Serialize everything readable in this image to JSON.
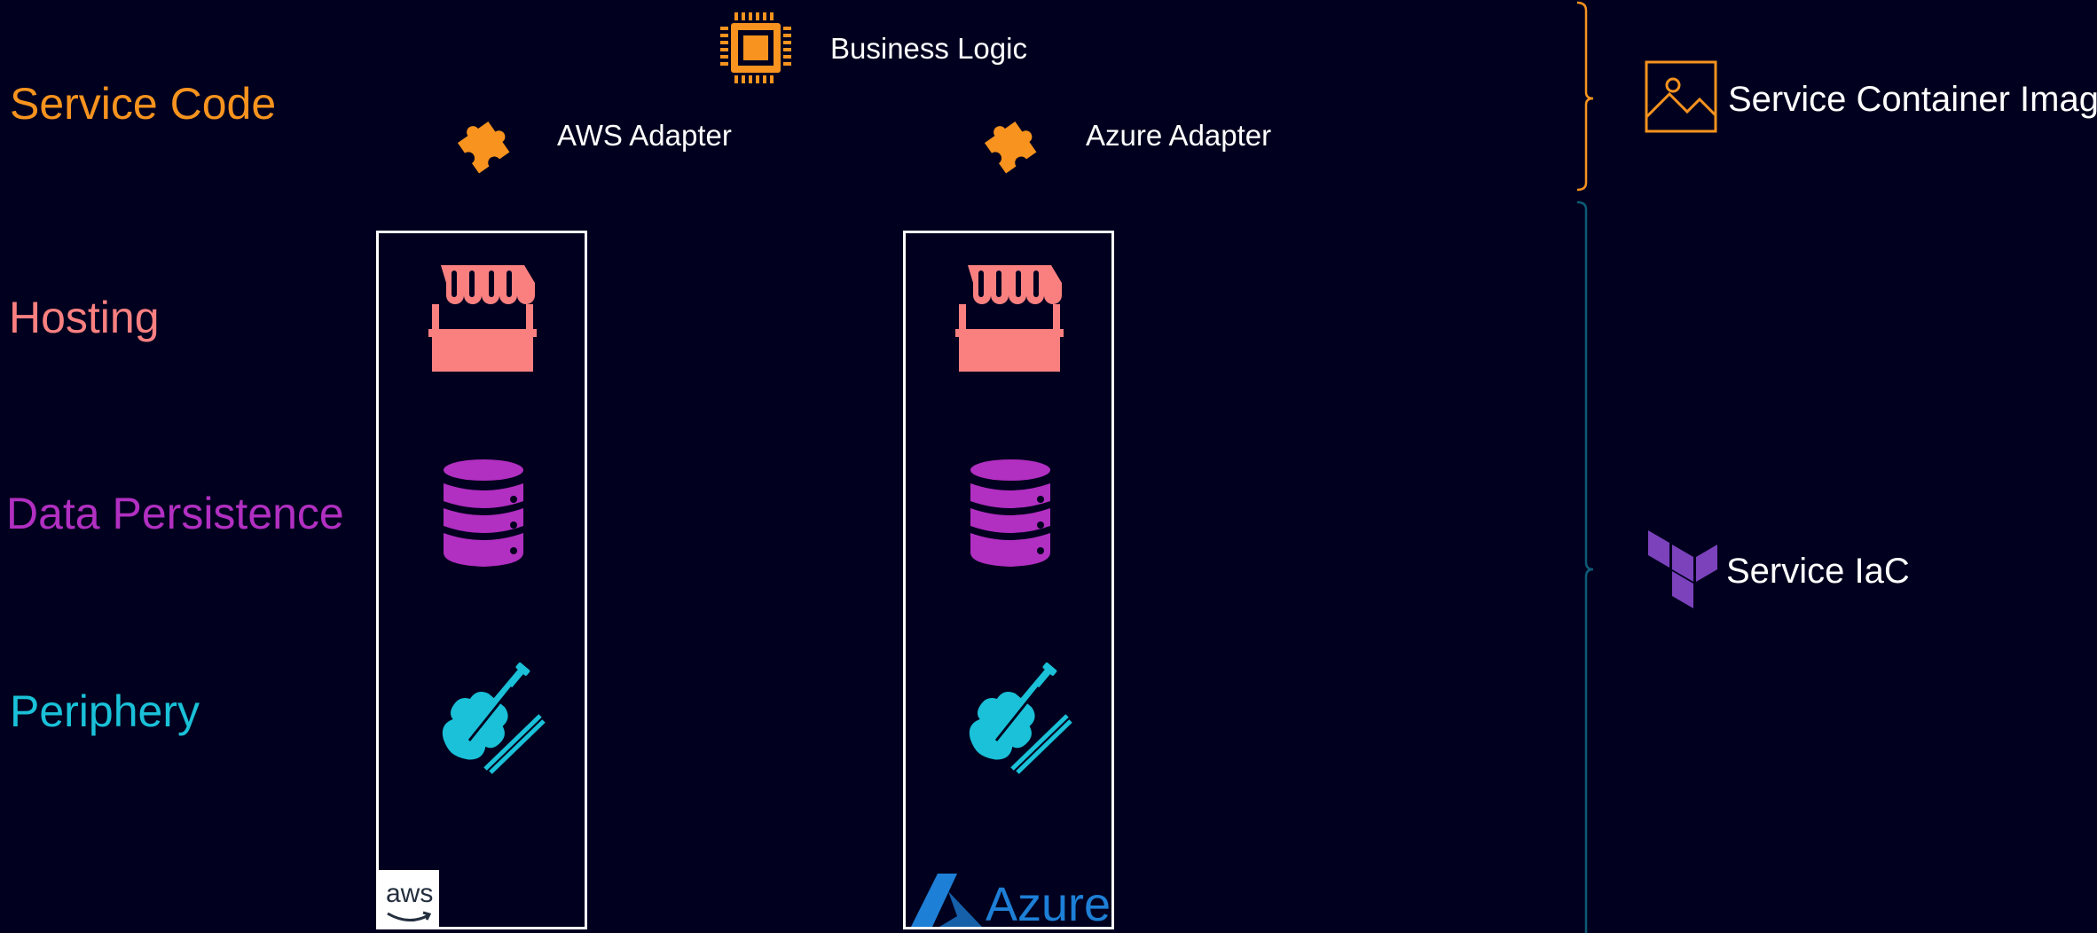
{
  "rows": {
    "service_code": {
      "label": "Service Code",
      "color": "#f7931e"
    },
    "hosting": {
      "label": "Hosting",
      "color": "#fa8080"
    },
    "data_persistence": {
      "label": "Data Persistence",
      "color": "#b12fc1"
    },
    "periphery": {
      "label": "Periphery",
      "color": "#1ac1d8"
    }
  },
  "service_code_items": {
    "business_logic": {
      "label": "Business Logic",
      "icon": "chip-icon"
    },
    "aws_adapter": {
      "label": "AWS Adapter",
      "icon": "puzzle-icon"
    },
    "azure_adapter": {
      "label": "Azure Adapter",
      "icon": "puzzle-icon"
    }
  },
  "columns": [
    {
      "provider": "aws",
      "logo_text": "aws",
      "icons": [
        "storefront-icon",
        "database-icon",
        "violin-icon"
      ]
    },
    {
      "provider": "azure",
      "logo_text": "Azure",
      "icons": [
        "storefront-icon",
        "database-icon",
        "violin-icon"
      ]
    }
  ],
  "groups": {
    "container_image": {
      "label": "Service Container Image",
      "icon": "image-icon",
      "bracket_color": "#f7931e"
    },
    "iac": {
      "label": "Service IaC",
      "icon": "terraform-icon",
      "bracket_color": "#0d5a75"
    }
  },
  "colors": {
    "background": "#01011f",
    "box_border": "#ffffff",
    "azure_blue": "#1e7fd6",
    "terraform_purple": "#7b42bc"
  }
}
